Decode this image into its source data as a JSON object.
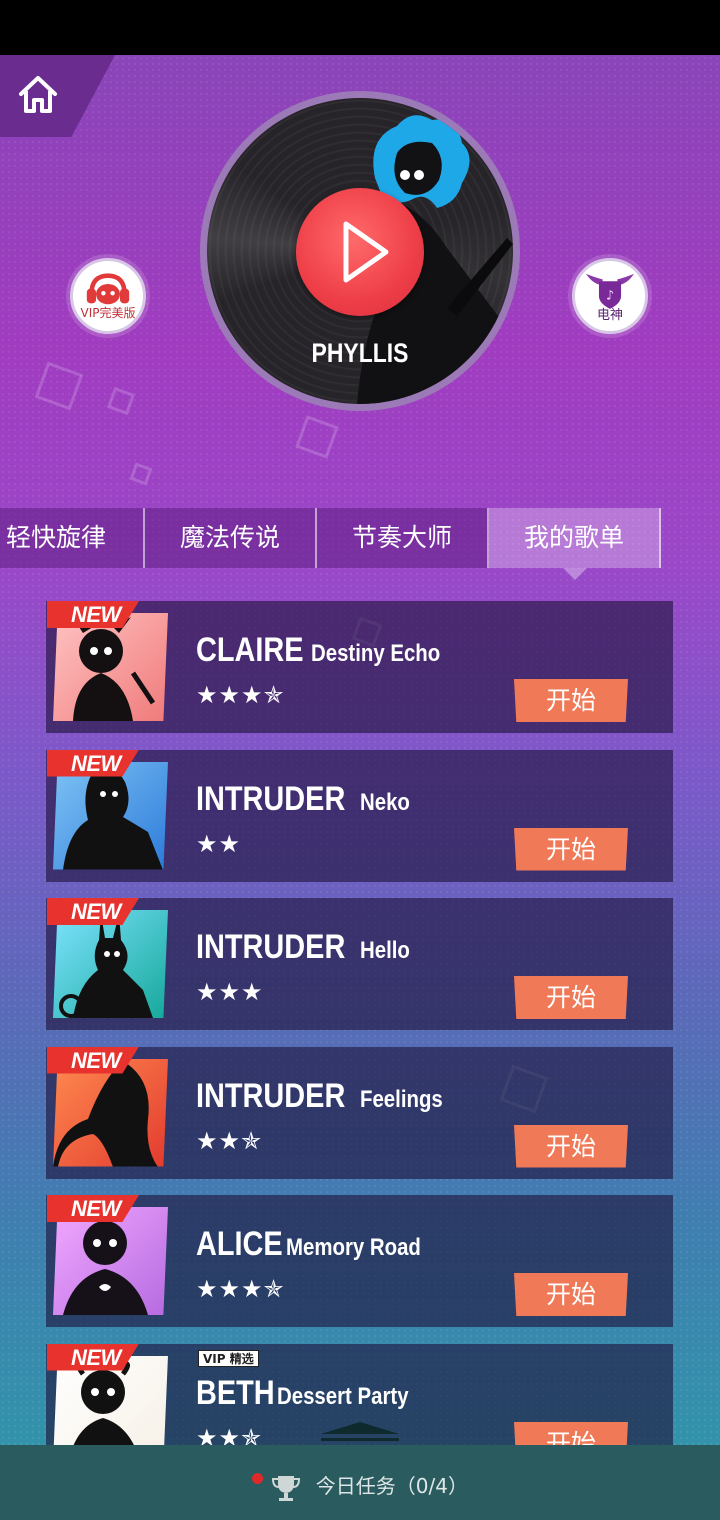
{
  "record": {
    "artist": "PHYLLIS"
  },
  "side_buttons": {
    "vip_label": "VIP完美版",
    "thunder_label": "电神"
  },
  "tabs": [
    {
      "label": "轻快旋律"
    },
    {
      "label": "魔法传说"
    },
    {
      "label": "节奏大师"
    },
    {
      "label": "我的歌单"
    }
  ],
  "songs": [
    {
      "badge": "NEW",
      "artist": "CLAIRE",
      "title": "Destiny Echo",
      "stars": "★★★✯",
      "start": "开始",
      "art_colors": [
        "#f07a7a",
        "#ffc3c3"
      ]
    },
    {
      "badge": "NEW",
      "artist": "INTRUDER",
      "title": "Neko",
      "stars": "★★",
      "start": "开始",
      "art_colors": [
        "#2c7ad9",
        "#7fc4f5"
      ]
    },
    {
      "badge": "NEW",
      "artist": "INTRUDER",
      "title": "Hello",
      "stars": "★★★",
      "start": "开始",
      "art_colors": [
        "#15a89a",
        "#7fe3ff"
      ]
    },
    {
      "badge": "NEW",
      "artist": "INTRUDER",
      "title": "Feelings",
      "stars": "★★✯",
      "start": "开始",
      "art_colors": [
        "#e23a2e",
        "#ff8a50"
      ]
    },
    {
      "badge": "NEW",
      "artist": "ALICE",
      "title": "Memory Road",
      "stars": "★★★✯",
      "start": "开始",
      "art_colors": [
        "#b56be0",
        "#f2a8ff"
      ]
    },
    {
      "badge": "NEW",
      "vip": "VIP 精选",
      "artist": "BETH",
      "title": "Dessert Party",
      "stars": "★★✯",
      "start": "开始",
      "art_colors": [
        "#f6f0e6",
        "#ffffff"
      ]
    }
  ],
  "mission": {
    "label": "今日任务（0/4）"
  }
}
